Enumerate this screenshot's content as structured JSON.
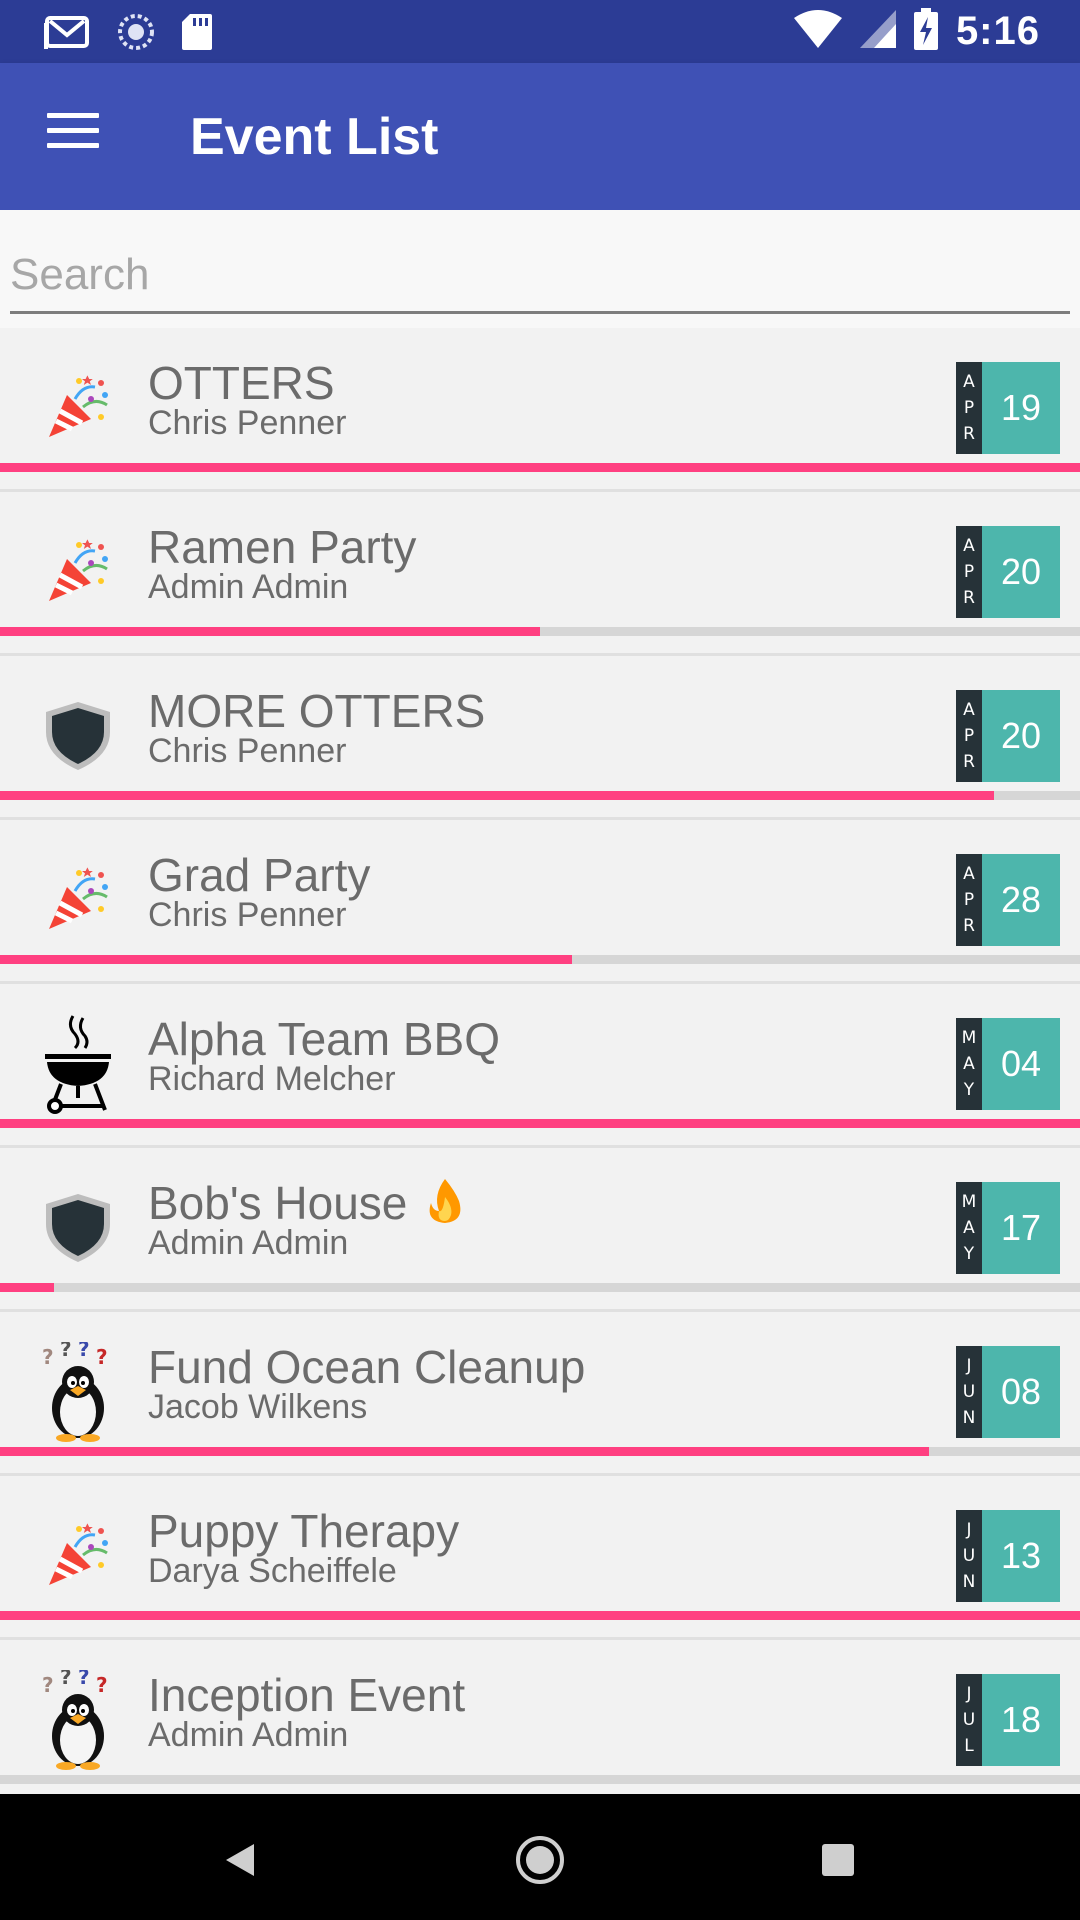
{
  "status_bar": {
    "time": "5:16",
    "left_icons": [
      "gmail-icon",
      "sync-icon",
      "sd-card-icon"
    ],
    "right_icons": [
      "wifi-icon",
      "signal-icon",
      "battery-charging-icon"
    ]
  },
  "app_bar": {
    "title": "Event List",
    "menu_icon": "hamburger-menu-icon"
  },
  "search": {
    "placeholder": "Search",
    "value": ""
  },
  "colors": {
    "status_bar": "#2c3c95",
    "app_bar": "#3f51b5",
    "progress": "#ff4081",
    "date_day": "#4db6ac",
    "date_month": "#263238"
  },
  "events": [
    {
      "title": "OTTERS",
      "owner": "Chris Penner",
      "month": [
        "A",
        "P",
        "R"
      ],
      "day": "19",
      "icon": "party-popper-icon",
      "progress": 1.0
    },
    {
      "title": "Ramen Party",
      "owner": "Admin Admin",
      "month": [
        "A",
        "P",
        "R"
      ],
      "day": "20",
      "icon": "party-popper-icon",
      "progress": 0.5
    },
    {
      "title": "MORE OTTERS",
      "owner": "Chris Penner",
      "month": [
        "A",
        "P",
        "R"
      ],
      "day": "20",
      "icon": "shield-icon",
      "progress": 0.92
    },
    {
      "title": "Grad Party",
      "owner": "Chris Penner",
      "month": [
        "A",
        "P",
        "R"
      ],
      "day": "28",
      "icon": "party-popper-icon",
      "progress": 0.53
    },
    {
      "title": "Alpha Team BBQ",
      "owner": "Richard Melcher",
      "month": [
        "M",
        "A",
        "Y"
      ],
      "day": "04",
      "icon": "bbq-grill-icon",
      "progress": 1.0
    },
    {
      "title": "Bob's House",
      "owner": "Admin Admin",
      "month": [
        "M",
        "A",
        "Y"
      ],
      "day": "17",
      "icon": "shield-icon",
      "progress": 0.05,
      "emoji": "fire-icon"
    },
    {
      "title": "Fund Ocean Cleanup",
      "owner": "Jacob Wilkens",
      "month": [
        "J",
        "U",
        "N"
      ],
      "day": "08",
      "icon": "penguin-icon",
      "progress": 0.86
    },
    {
      "title": "Puppy Therapy",
      "owner": "Darya Scheiffele",
      "month": [
        "J",
        "U",
        "N"
      ],
      "day": "13",
      "icon": "party-popper-icon",
      "progress": 1.0
    },
    {
      "title": "Inception Event",
      "owner": "Admin Admin",
      "month": [
        "J",
        "U",
        "L"
      ],
      "day": "18",
      "icon": "penguin-icon",
      "progress": 0.0
    }
  ],
  "nav_bar": {
    "buttons": [
      "back-icon",
      "home-icon",
      "recents-icon"
    ]
  }
}
